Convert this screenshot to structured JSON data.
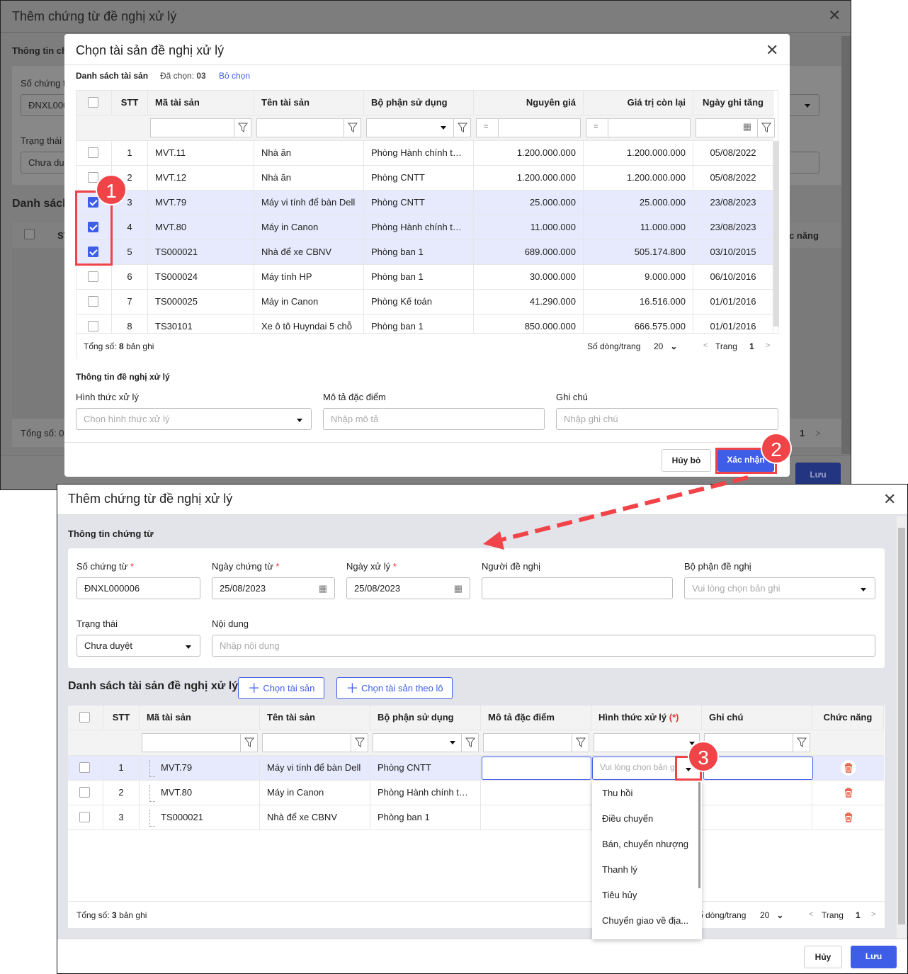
{
  "bg": {
    "title": "Thêm chứng từ đề nghị xử lý",
    "section": "Thông tin ch",
    "so_label": "Số chứng t",
    "so_val": "ĐNXL000",
    "trang_thai": "Trạng thái",
    "trang_thai_val": "Chưa du",
    "ds": "Danh sách",
    "st": "ST",
    "chuc_nang": "c năng",
    "total": "Tổng số: 0",
    "page": "1",
    "next": ">",
    "save": "Lưu"
  },
  "modal": {
    "title": "Chọn tài sản đề nghị xử lý",
    "list_label": "Danh sách tài sản",
    "selected_label": "Đã chọn:",
    "selected_count": "03",
    "deselect": "Bỏ chọn",
    "columns": [
      "STT",
      "Mã tài sản",
      "Tên tài sản",
      "Bộ phận sử dụng",
      "Nguyên giá",
      "Giá trị còn lại",
      "Ngày ghi tăng"
    ],
    "eq": "=",
    "rows": [
      {
        "checked": false,
        "stt": "1",
        "ma": "MVT.11",
        "ten": "Nhà ăn",
        "bp": "Phòng Hành chính tổng...",
        "ng": "1.200.000.000",
        "gt": "1.200.000.000",
        "ngay": "05/08/2022"
      },
      {
        "checked": false,
        "stt": "2",
        "ma": "MVT.12",
        "ten": "Nhà ăn",
        "bp": "Phòng CNTT",
        "ng": "1.200.000.000",
        "gt": "1.200.000.000",
        "ngay": "05/08/2022"
      },
      {
        "checked": true,
        "stt": "3",
        "ma": "MVT.79",
        "ten": "Máy vi tính để bàn Dell",
        "bp": "Phòng CNTT",
        "ng": "25.000.000",
        "gt": "25.000.000",
        "ngay": "23/08/2023"
      },
      {
        "checked": true,
        "stt": "4",
        "ma": "MVT.80",
        "ten": "Máy in Canon",
        "bp": "Phòng Hành chính tổng...",
        "ng": "11.000.000",
        "gt": "11.000.000",
        "ngay": "23/08/2023"
      },
      {
        "checked": true,
        "stt": "5",
        "ma": "TS000021",
        "ten": "Nhà để xe CBNV",
        "bp": "Phòng ban 1",
        "ng": "689.000.000",
        "gt": "505.174.800",
        "ngay": "03/10/2015"
      },
      {
        "checked": false,
        "stt": "6",
        "ma": "TS000024",
        "ten": "Máy tính HP",
        "bp": "Phòng ban 1",
        "ng": "30.000.000",
        "gt": "9.000.000",
        "ngay": "06/10/2016"
      },
      {
        "checked": false,
        "stt": "7",
        "ma": "TS000025",
        "ten": "Máy in Canon",
        "bp": "Phòng Kế toán",
        "ng": "41.290.000",
        "gt": "16.516.000",
        "ngay": "01/01/2016"
      },
      {
        "checked": false,
        "stt": "8",
        "ma": "TS30101",
        "ten": "Xe ô tô Huyndai 5 chỗ",
        "bp": "Phòng ban 1",
        "ng": "850.000.000",
        "gt": "666.575.000",
        "ngay": "01/01/2016"
      }
    ],
    "total_prefix": "Tổng số:",
    "total_count": "8",
    "total_suffix": "bản ghi",
    "rows_per_page_label": "Số dòng/trang",
    "rows_per_page": "20",
    "page_label": "Trang",
    "page": "1",
    "prev": "<",
    "next": ">",
    "proposal_title": "Thông tin đề nghị xử lý",
    "hinh_thuc_label": "Hình thức xử lý",
    "hinh_thuc_ph": "Chọn hình thức xử lý",
    "mo_ta_label": "Mô tả đặc điểm",
    "mo_ta_ph": "Nhập mô tả",
    "ghi_chu_label": "Ghi chú",
    "ghi_chu_ph": "Nhập ghi chú",
    "cancel": "Hủy bỏ",
    "confirm": "Xác nhận"
  },
  "form": {
    "title": "Thêm chứng từ đề nghị xử lý",
    "section": "Thông tin chứng từ",
    "required": "*",
    "so_label": "Số chứng từ",
    "so_val": "ĐNXL000006",
    "ngay_ct_label": "Ngày chứng từ",
    "ngay_ct_val": "25/08/2023",
    "ngay_xl_label": "Ngày xử lý",
    "ngay_xl_val": "25/08/2023",
    "nguoi_label": "Người đề nghị",
    "bp_label": "Bộ phận đề nghị",
    "bp_ph": "Vui lòng chọn bản ghi",
    "tt_label": "Trạng thái",
    "tt_val": "Chưa duyệt",
    "nd_label": "Nội dung",
    "nd_ph": "Nhập nội dung",
    "list_title": "Danh sách tài sản đề nghị xử lý",
    "add_btn": "Chọn tài sản",
    "add_batch_btn": "Chọn tài sản theo lô",
    "columns": [
      "STT",
      "Mã tài sản",
      "Tên tài sản",
      "Bộ phận sử dụng",
      "Mô tả đặc điểm",
      "Hình thức xử lý",
      "Ghi chú",
      "Chức năng"
    ],
    "req_mark": "(*)",
    "rows": [
      {
        "stt": "1",
        "ma": "MVT.79",
        "ten": "Máy vi tính để bàn Dell",
        "bp": "Phòng CNTT"
      },
      {
        "stt": "2",
        "ma": "MVT.80",
        "ten": "Máy in Canon",
        "bp": "Phòng Hành chính tổng..."
      },
      {
        "stt": "3",
        "ma": "TS000021",
        "ten": "Nhà để xe CBNV",
        "bp": "Phòng ban 1"
      }
    ],
    "row_select_ph": "Vui lòng chọn bản g",
    "dropdown_options": [
      "Thu hồi",
      "Điều chuyển",
      "Bán, chuyển nhượng",
      "Thanh lý",
      "Tiêu hủy",
      "Chuyển giao về địa..."
    ],
    "total_prefix": "Tổng số:",
    "total_count": "3",
    "total_suffix": "bản ghi",
    "rows_per_page_label": "ố dòng/trang",
    "rows_per_page": "20",
    "page_label": "Trang",
    "page": "1",
    "prev": "<",
    "next": ">",
    "cancel": "Hủy",
    "save": "Lưu"
  },
  "annotations": [
    "1",
    "2",
    "3"
  ],
  "colors": {
    "primary": "#3f5ee8",
    "annotation": "#f04449",
    "delete": "#e8553a"
  }
}
